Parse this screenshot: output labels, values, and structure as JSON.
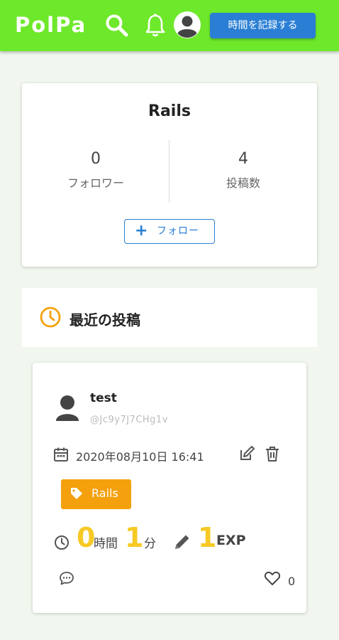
{
  "header": {
    "logo": "PolPa",
    "record_button": "時間を記録する",
    "icons": [
      "search-icon",
      "bell-icon",
      "account-avatar-icon"
    ],
    "bar_color": "#6ee82a",
    "button_color": "#2a7fd4"
  },
  "profile": {
    "name": "Rails",
    "followers": {
      "value": "0",
      "label": "フォロワー"
    },
    "posts": {
      "value": "4",
      "label": "投稿数"
    },
    "follow_button": "フォロー"
  },
  "recent": {
    "title": "最近の投稿"
  },
  "post": {
    "user": "test",
    "handle": "@Jc9y7J7CHg1v",
    "date": "2020年08月10日 16:41",
    "tag": "Rails",
    "hours": "0",
    "hours_unit": "時間",
    "minutes": "1",
    "minutes_unit": "分",
    "exp": "1",
    "exp_unit": "EXP",
    "likes": "0",
    "tag_color": "#f4a10d",
    "number_color": "#f7c925"
  }
}
